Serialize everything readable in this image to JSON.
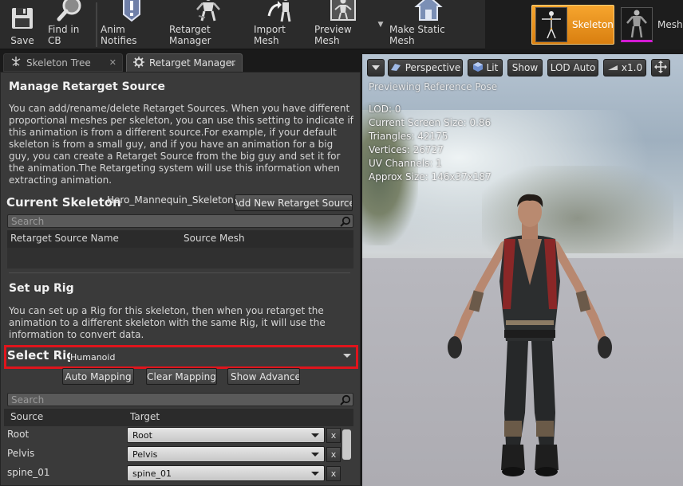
{
  "toolbar": {
    "items": [
      {
        "label": "Save",
        "icon": "save-icon"
      },
      {
        "label": "Find in CB",
        "icon": "magnifier-icon"
      },
      {
        "label": "Anim Notifies",
        "icon": "notify-icon"
      },
      {
        "label": "Retarget Manager",
        "icon": "retarget-icon"
      },
      {
        "label": "Import Mesh",
        "icon": "import-icon"
      },
      {
        "label": "Preview Mesh",
        "icon": "preview-mesh-icon"
      },
      {
        "label": "Make Static Mesh",
        "icon": "house-icon"
      }
    ]
  },
  "modes": {
    "skeleton": "Skeleton",
    "mesh": "Mesh"
  },
  "tabs": [
    {
      "label": "Skeleton Tree"
    },
    {
      "label": "Retarget Manager"
    }
  ],
  "retarget_source": {
    "title": "Manage Retarget Source",
    "description": "You can add/rename/delete Retarget Sources. When you have different proportional meshes per skeleton, you can use this setting to indicate if this animation is from a different source.For example, if your default skeleton is from a small guy, and if you have an animation for a big guy, you can create a Retarget Source from the big guy and set it for the animation.The Retargeting system will use this information when extracting animation.",
    "current_skeleton_label": "Current Skeleton",
    "current_skeleton_value": "Hero_Mannequin_Skeleton",
    "add_button": "Add New Retarget Source",
    "search_placeholder": "Search",
    "col_name": "Retarget Source Name",
    "col_mesh": "Source Mesh"
  },
  "rig": {
    "title": "Set up Rig",
    "description": "You can set up a Rig for this skeleton, then when you retarget the animation to a different skeleton with the same Rig, it will use the information to convert data.",
    "select_label": "Select Rig",
    "selected": "Humanoid",
    "auto_mapping": "Auto  Mapping",
    "clear_mapping": "Clear Mapping",
    "show_advanced": "Show Advanced",
    "search_placeholder": "Search",
    "col_source": "Source",
    "col_target": "Target",
    "clear_label": "x",
    "rows": [
      {
        "source": "Root",
        "target": "Root"
      },
      {
        "source": "Pelvis",
        "target": "Pelvis"
      },
      {
        "source": "spine_01",
        "target": "spine_01"
      }
    ]
  },
  "viewport": {
    "perspective": "Perspective",
    "lit": "Lit",
    "show": "Show",
    "lod": "LOD Auto",
    "speed": "x1.0",
    "previewing": "Previewing Reference Pose",
    "stats": [
      "LOD: 0",
      "Current Screen Size: 0.86",
      "Triangles: 42175",
      "Vertices: 26727",
      "UV Channels: 1",
      "Approx Size: 146x37x187"
    ]
  }
}
